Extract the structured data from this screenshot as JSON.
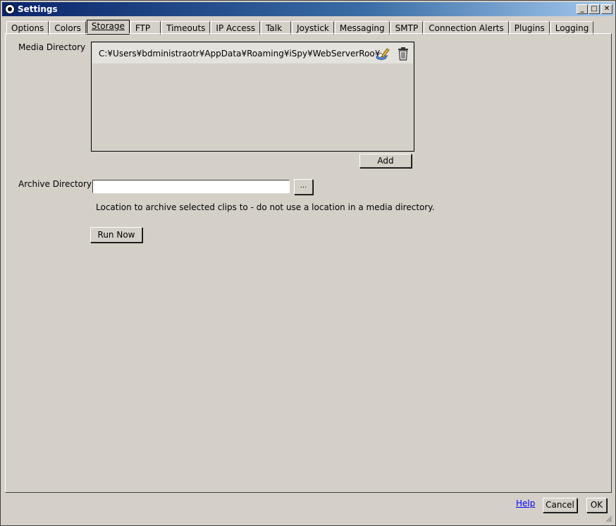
{
  "window": {
    "title": "Settings",
    "minimize": "_",
    "maximize": "□",
    "close": "✕"
  },
  "tabs": [
    {
      "label": "Options"
    },
    {
      "label": "Colors"
    },
    {
      "label": "Storage"
    },
    {
      "label": "FTP"
    },
    {
      "label": "Timeouts"
    },
    {
      "label": "IP Access"
    },
    {
      "label": "Talk"
    },
    {
      "label": "Joystick"
    },
    {
      "label": "Messaging"
    },
    {
      "label": "SMTP"
    },
    {
      "label": "Connection Alerts"
    },
    {
      "label": "Plugins"
    },
    {
      "label": "Logging"
    }
  ],
  "active_tab": "Storage",
  "storage": {
    "media_directory_label": "Media Directory",
    "media_directories": [
      {
        "path": "C:¥Users¥bdministraotr¥AppData¥Roaming¥iSpy¥WebServerRoo¥..."
      }
    ],
    "add_button": "Add",
    "archive_directory_label": "Archive Directory",
    "archive_directory_value": "",
    "browse_button": "...",
    "archive_hint": "Location to archive selected clips to - do not use a location in a media directory.",
    "run_now_button": "Run Now"
  },
  "footer": {
    "help_link": "Help",
    "cancel_button": "Cancel",
    "ok_button": "OK"
  },
  "colors": {
    "accent_title": "#0a246a",
    "link": "#0000ff",
    "face": "#d4d0c8"
  }
}
